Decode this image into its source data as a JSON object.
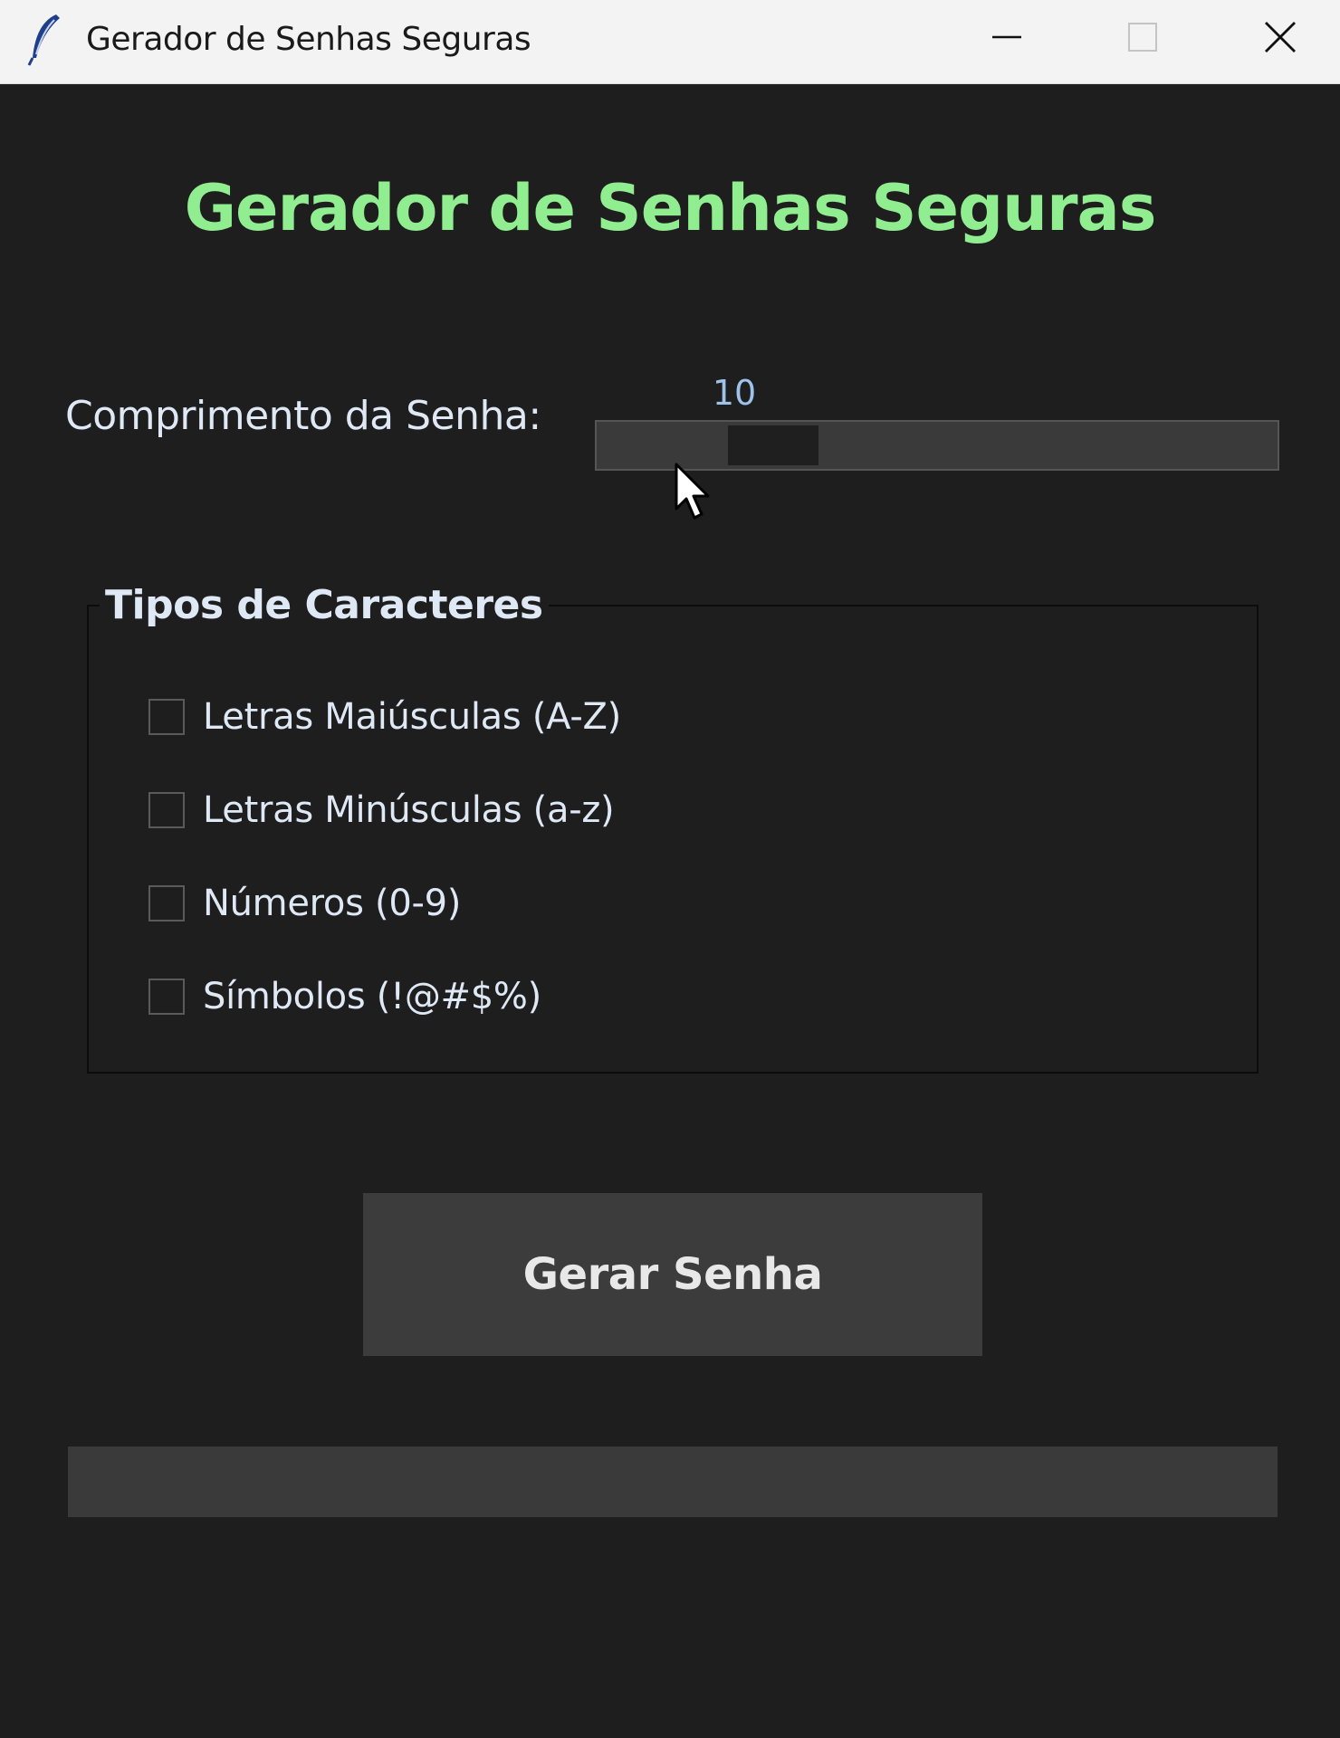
{
  "window": {
    "title": "Gerador de Senhas Seguras",
    "icons": {
      "app": "feather-icon",
      "minimize": "minimize-icon",
      "maximize": "maximize-icon",
      "close": "close-icon"
    }
  },
  "header": {
    "title": "Gerador de Senhas Seguras",
    "title_color": "#90ee90"
  },
  "length": {
    "label": "Comprimento da Senha:",
    "value": "10",
    "slider_fraction": 0.22
  },
  "char_types": {
    "title": "Tipos de Caracteres",
    "options": [
      {
        "label": "Letras Maiúsculas (A-Z)",
        "checked": false
      },
      {
        "label": "Letras Minúsculas (a-z)",
        "checked": false
      },
      {
        "label": "Números (0-9)",
        "checked": false
      },
      {
        "label": "Símbolos (!@#$%)",
        "checked": false
      }
    ]
  },
  "actions": {
    "generate_label": "Gerar Senha"
  },
  "output": {
    "value": "",
    "placeholder": ""
  },
  "colors": {
    "background": "#1e1e1e",
    "panel": "#3a3a3a",
    "accent": "#90ee90",
    "text": "#dfe8f5",
    "value_text": "#9ec3ea"
  }
}
